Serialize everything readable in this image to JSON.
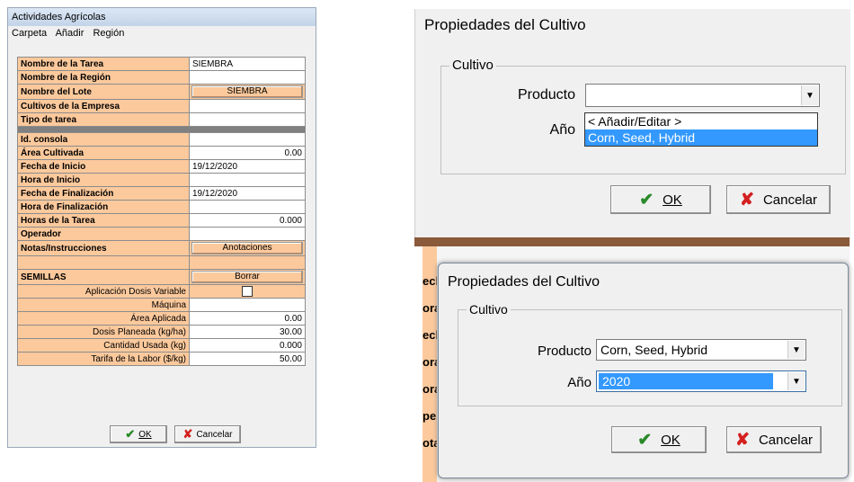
{
  "main_window": {
    "title": "Actividades Agrícolas",
    "menu": [
      "Carpeta",
      "Añadir",
      "Región"
    ],
    "rows": [
      {
        "label": "Nombre de la Tarea",
        "value": "SIEMBRA",
        "kind": "text"
      },
      {
        "label": "Nombre de la Región",
        "value": "",
        "kind": "text"
      },
      {
        "label": "Nombre del Lote",
        "value": "SIEMBRA",
        "kind": "button"
      },
      {
        "label": "Cultivos de la Empresa",
        "value": "",
        "kind": "text"
      },
      {
        "label": "Tipo de tarea",
        "value": "",
        "kind": "text"
      },
      {
        "label": "",
        "value": "",
        "kind": "separator"
      },
      {
        "label": "Id. consola",
        "value": "",
        "kind": "text"
      },
      {
        "label": "Área Cultivada",
        "value": "0.00",
        "kind": "number"
      },
      {
        "label": "Fecha de Inicio",
        "value": "19/12/2020",
        "kind": "text"
      },
      {
        "label": "Hora de Inicio",
        "value": "",
        "kind": "text"
      },
      {
        "label": "Fecha de Finalización",
        "value": "19/12/2020",
        "kind": "text"
      },
      {
        "label": "Hora de Finalización",
        "value": "",
        "kind": "text"
      },
      {
        "label": "Horas de la Tarea",
        "value": "0.000",
        "kind": "number"
      },
      {
        "label": "Operador",
        "value": "",
        "kind": "text"
      },
      {
        "label": "Notas/Instrucciones",
        "value": "Anotaciones",
        "kind": "button"
      },
      {
        "label": "",
        "value": "",
        "kind": "blank"
      },
      {
        "label": "SEMILLAS",
        "value": "Borrar",
        "kind": "button"
      },
      {
        "label": "Aplicación Dosis Variable",
        "value": "",
        "kind": "checkbox",
        "sub": true
      },
      {
        "label": "Máquina",
        "value": "",
        "kind": "text",
        "sub": true
      },
      {
        "label": "Área Aplicada",
        "value": "0.00",
        "kind": "number",
        "sub": true
      },
      {
        "label": "Dosis Planeada (kg/ha)",
        "value": "30.00",
        "kind": "number",
        "sub": true
      },
      {
        "label": "Cantidad Usada (kg)",
        "value": "0.000",
        "kind": "number",
        "sub": true
      },
      {
        "label": "Tarifa de la Labor ($/kg)",
        "value": "50.00",
        "kind": "number",
        "sub": true
      }
    ],
    "ok_label": "OK",
    "cancel_label": "Cancelar"
  },
  "dialog_top": {
    "title": "Propiedades del Cultivo",
    "group_label": "Cultivo",
    "producto_label": "Producto",
    "producto_value": "",
    "anio_label": "Año",
    "dropdown_options": [
      "< Añadir/Editar >",
      "Corn, Seed, Hybrid"
    ],
    "ok_label": "OK",
    "cancel_label": "Cancelar"
  },
  "dialog_bottom": {
    "title": "Propiedades del Cultivo",
    "group_label": "Cultivo",
    "producto_label": "Producto",
    "producto_value": "Corn, Seed, Hybrid",
    "anio_label": "Año",
    "anio_value": "2020",
    "ok_label": "OK",
    "cancel_label": "Cancelar",
    "background_fragments": [
      "ech",
      "ora",
      "ech",
      "ora",
      "ora",
      "pe",
      "ota"
    ]
  },
  "colors": {
    "label_bg": "#fcc99c",
    "selection": "#3399ff",
    "ok_check": "#2a8a2a",
    "cancel_x": "#d42020"
  }
}
